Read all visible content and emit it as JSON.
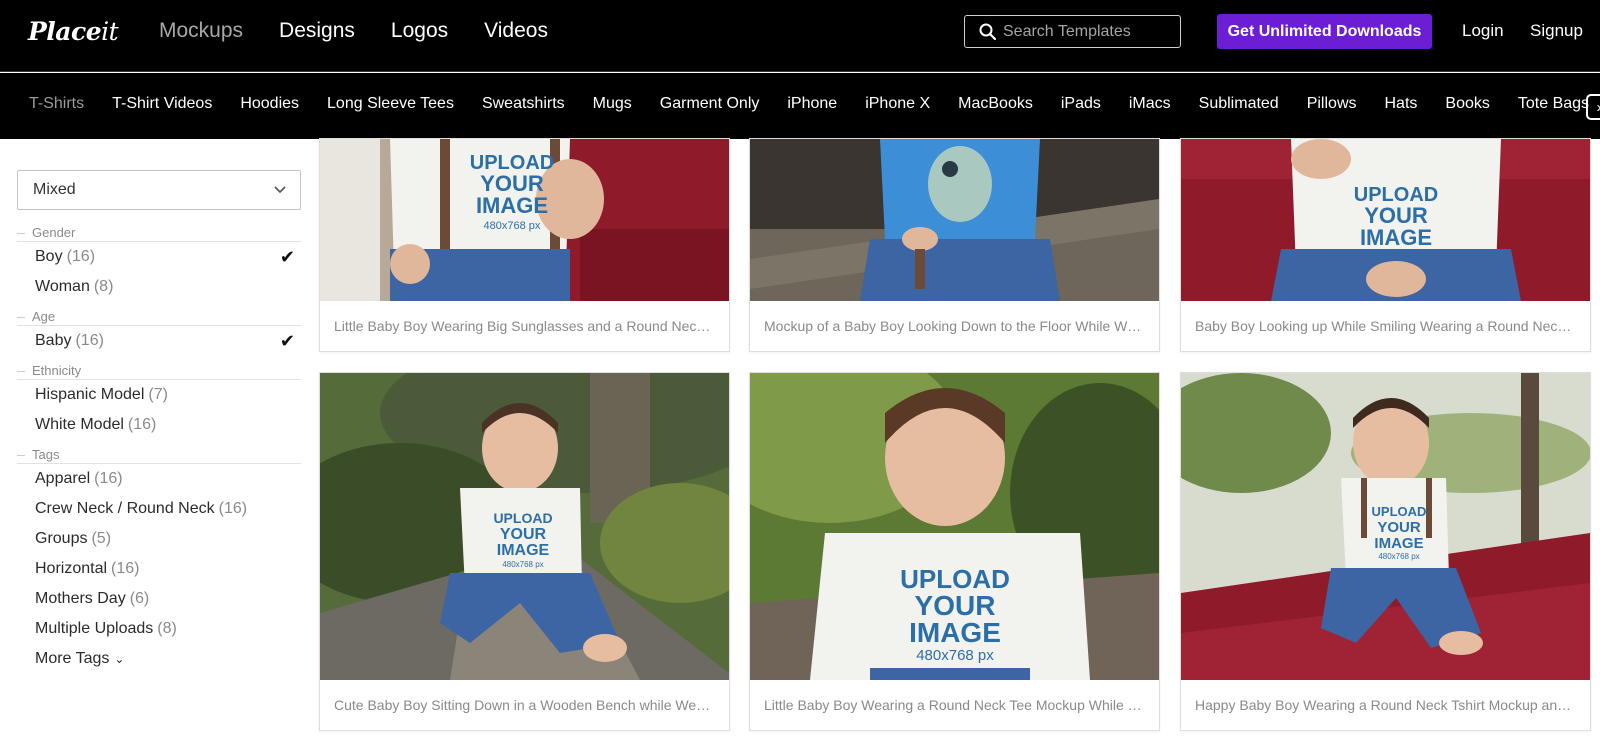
{
  "brand": {
    "logo_main": "Place",
    "logo_suffix": "it"
  },
  "main_nav": [
    {
      "label": "Mockups",
      "active": true
    },
    {
      "label": "Designs"
    },
    {
      "label": "Logos"
    },
    {
      "label": "Videos"
    }
  ],
  "search": {
    "placeholder": "Search Templates",
    "value": ""
  },
  "cta": {
    "label": "Get Unlimited Downloads"
  },
  "auth": {
    "login": "Login",
    "signup": "Signup"
  },
  "categories": [
    "T-Shirts",
    "T-Shirt Videos",
    "Hoodies",
    "Long Sleeve Tees",
    "Sweatshirts",
    "Mugs",
    "Garment Only",
    "iPhone",
    "iPhone X",
    "MacBooks",
    "iPads",
    "iMacs",
    "Sublimated",
    "Pillows",
    "Hats",
    "Books",
    "Tote Bags"
  ],
  "sidebar": {
    "sort_select": "Mixed",
    "groups": [
      {
        "title": "Gender",
        "items": [
          {
            "label": "Boy",
            "count": "(16)",
            "checked": true
          },
          {
            "label": "Woman",
            "count": "(8)"
          }
        ]
      },
      {
        "title": "Age",
        "items": [
          {
            "label": "Baby",
            "count": "(16)",
            "checked": true
          }
        ]
      },
      {
        "title": "Ethnicity",
        "items": [
          {
            "label": "Hispanic Model",
            "count": "(7)"
          },
          {
            "label": "White Model",
            "count": "(16)"
          }
        ]
      },
      {
        "title": "Tags",
        "items": [
          {
            "label": "Apparel",
            "count": "(16)"
          },
          {
            "label": "Crew Neck / Round Neck",
            "count": "(16)"
          },
          {
            "label": "Groups",
            "count": "(5)"
          },
          {
            "label": "Horizontal",
            "count": "(16)"
          },
          {
            "label": "Mothers Day",
            "count": "(6)"
          },
          {
            "label": "Multiple Uploads",
            "count": "(8)"
          }
        ]
      }
    ],
    "more_tags": "More Tags"
  },
  "cards": [
    {
      "caption": "Little Baby Boy Wearing Big Sunglasses and a Round Neck Tee Mockup"
    },
    {
      "caption": "Mockup of a Baby Boy Looking Down to the Floor While Wearing a Tshirt"
    },
    {
      "caption": "Baby Boy Looking up While Smiling Wearing a Round Neck Tee Mockup"
    },
    {
      "caption": "Cute Baby Boy Sitting Down in a Wooden Bench while Wearing a Tshirt Mockup"
    },
    {
      "caption": "Little Baby Boy Wearing a Round Neck Tee Mockup While Sitting Outdoors"
    },
    {
      "caption": "Happy Baby Boy Wearing a Round Neck Tshirt Mockup and Suspenders"
    }
  ],
  "shirt_print": {
    "line1": "UPLOAD",
    "line2": "YOUR",
    "line3": "IMAGE",
    "line4": "480x768 px"
  },
  "colors": {
    "accent": "#6c1ed4",
    "bench_red": "#8e1a2a",
    "denim": "#3d64a3"
  }
}
